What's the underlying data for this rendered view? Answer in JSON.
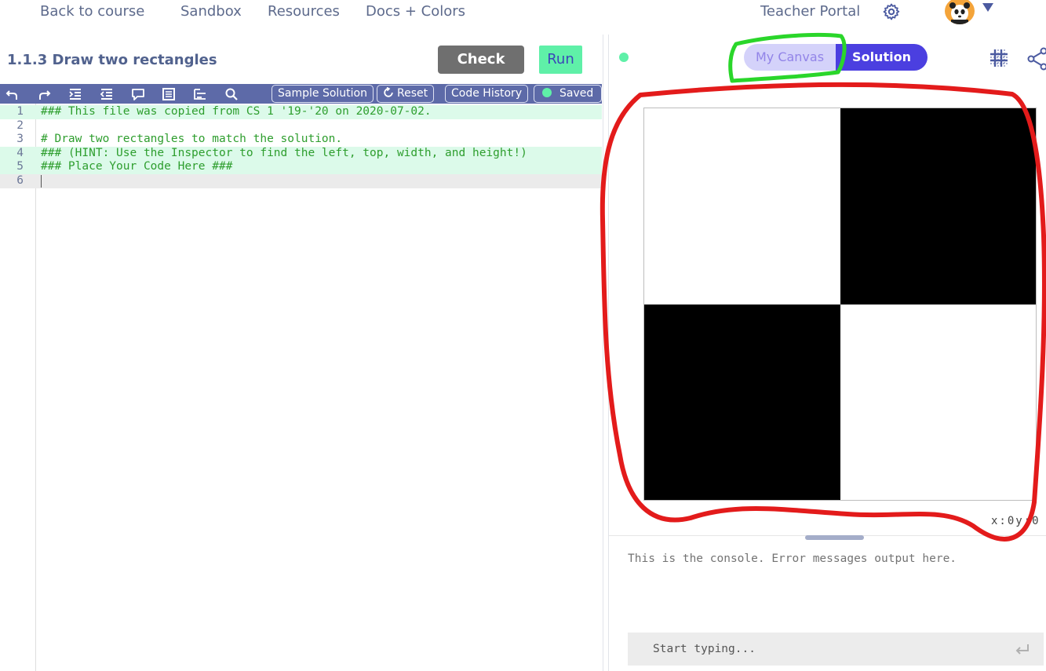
{
  "nav": {
    "back_to_course": "Back to course",
    "sandbox": "Sandbox",
    "resources": "Resources",
    "docs_colors": "Docs + Colors",
    "teacher_portal": "Teacher Portal"
  },
  "icons": {
    "settings": "gear-icon",
    "avatar": "panda-avatar",
    "avatar_caret": "caret-down-icon",
    "undo": "undo-icon",
    "redo": "redo-icon",
    "indent": "indent-icon",
    "outdent": "outdent-icon",
    "comment": "comment-icon",
    "format": "format-icon",
    "wrap": "wrap-icon",
    "search": "search-icon",
    "reset": "reset-icon",
    "grid": "grid-icon",
    "share": "share-icon",
    "enter": "enter-icon"
  },
  "editor": {
    "lesson_title": "1.1.3 Draw two rectangles",
    "check_code_label": "Check Code",
    "run_label": "Run",
    "toolbar": {
      "sample_solution": "Sample Solution",
      "reset": "Reset",
      "code_history": "Code History",
      "saved": "Saved"
    },
    "lines": [
      {
        "num": "1",
        "text": "### This file was copied from CS 1 '19-'20 on 2020-07-02."
      },
      {
        "num": "2",
        "text": ""
      },
      {
        "num": "3",
        "text": "# Draw two rectangles to match the solution."
      },
      {
        "num": "4",
        "text": "### (HINT: Use the Inspector to find the left, top, width, and height!)"
      },
      {
        "num": "5",
        "text": "### Place Your Code Here ###"
      },
      {
        "num": "6",
        "text": ""
      }
    ]
  },
  "viewer": {
    "tab_my_canvas": "My Canvas",
    "tab_solution": "Solution",
    "coords": "x:0y:0",
    "console_message": "This is the console. Error messages output here.",
    "console_placeholder": "Start typing..."
  },
  "colors": {
    "toolbar": "#5d6aa8",
    "accent_green": "#5ff0a8",
    "solution_tab": "#4b3fe0",
    "mycanvas_tab": "#d4d2fa",
    "annotation_red": "#e31b1b",
    "annotation_green": "#2ad62a"
  }
}
